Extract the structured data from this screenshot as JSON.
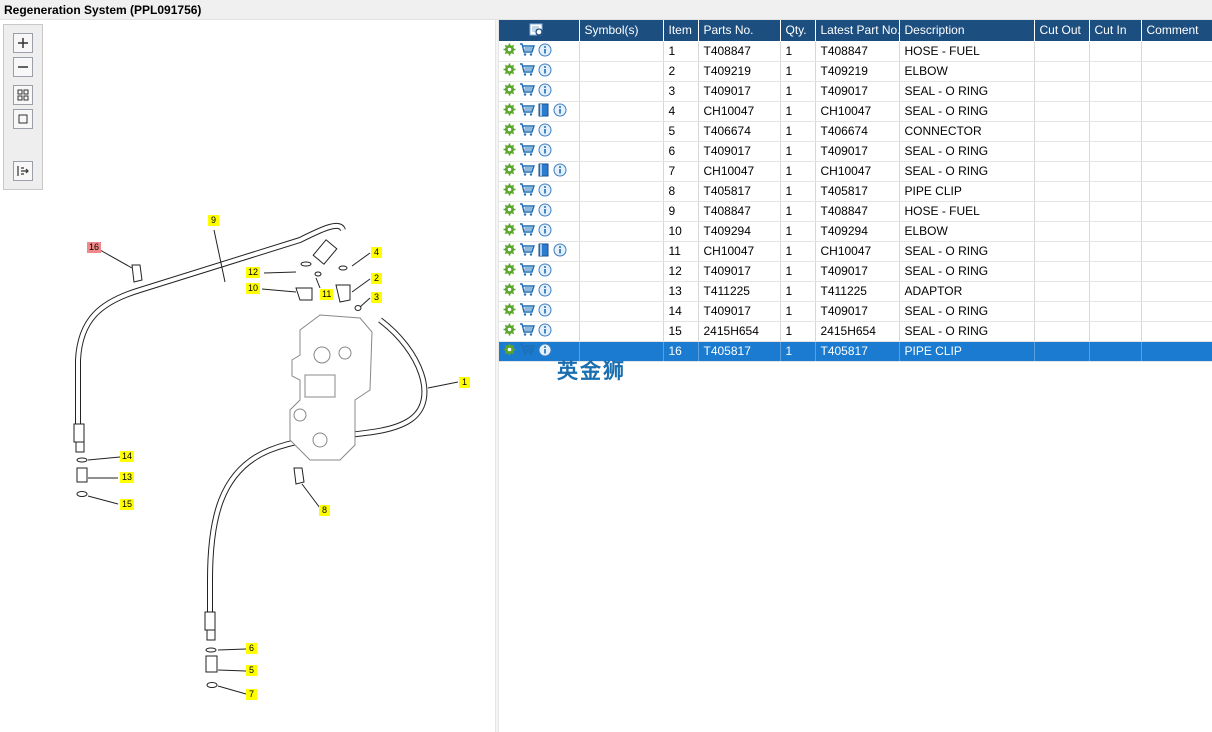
{
  "window": {
    "title": "Regeneration System (PPL091756)"
  },
  "toolbar": {
    "buttons": [
      "zoom-in-icon",
      "zoom-out-icon",
      "fit-all-icon",
      "fit-window-icon",
      "panel-toggle-icon"
    ]
  },
  "drawing": {
    "callouts": [
      "9",
      "16",
      "12",
      "4",
      "2",
      "10",
      "11",
      "3",
      "1",
      "14",
      "13",
      "15",
      "8",
      "6",
      "5",
      "7"
    ],
    "highlighted_callout": "16"
  },
  "table": {
    "columns": [
      "",
      "Symbol(s)",
      "Item",
      "Parts No.",
      "Qty.",
      "Latest Part No.",
      "Description",
      "Cut Out",
      "Cut In",
      "Comment"
    ],
    "rows": [
      {
        "item": "1",
        "parts_no": "T408847",
        "qty": "1",
        "latest": "T408847",
        "desc": "HOSE - FUEL",
        "doc": false
      },
      {
        "item": "2",
        "parts_no": "T409219",
        "qty": "1",
        "latest": "T409219",
        "desc": "ELBOW",
        "doc": false
      },
      {
        "item": "3",
        "parts_no": "T409017",
        "qty": "1",
        "latest": "T409017",
        "desc": "SEAL - O RING",
        "doc": false
      },
      {
        "item": "4",
        "parts_no": "CH10047",
        "qty": "1",
        "latest": "CH10047",
        "desc": "SEAL - O RING",
        "doc": true
      },
      {
        "item": "5",
        "parts_no": "T406674",
        "qty": "1",
        "latest": "T406674",
        "desc": "CONNECTOR",
        "doc": false
      },
      {
        "item": "6",
        "parts_no": "T409017",
        "qty": "1",
        "latest": "T409017",
        "desc": "SEAL - O RING",
        "doc": false
      },
      {
        "item": "7",
        "parts_no": "CH10047",
        "qty": "1",
        "latest": "CH10047",
        "desc": "SEAL - O RING",
        "doc": true
      },
      {
        "item": "8",
        "parts_no": "T405817",
        "qty": "1",
        "latest": "T405817",
        "desc": "PIPE CLIP",
        "doc": false
      },
      {
        "item": "9",
        "parts_no": "T408847",
        "qty": "1",
        "latest": "T408847",
        "desc": "HOSE - FUEL",
        "doc": false
      },
      {
        "item": "10",
        "parts_no": "T409294",
        "qty": "1",
        "latest": "T409294",
        "desc": "ELBOW",
        "doc": false
      },
      {
        "item": "11",
        "parts_no": "CH10047",
        "qty": "1",
        "latest": "CH10047",
        "desc": "SEAL - O RING",
        "doc": true
      },
      {
        "item": "12",
        "parts_no": "T409017",
        "qty": "1",
        "latest": "T409017",
        "desc": "SEAL - O RING",
        "doc": false
      },
      {
        "item": "13",
        "parts_no": "T411225",
        "qty": "1",
        "latest": "T411225",
        "desc": "ADAPTOR",
        "doc": false
      },
      {
        "item": "14",
        "parts_no": "T409017",
        "qty": "1",
        "latest": "T409017",
        "desc": "SEAL - O RING",
        "doc": false
      },
      {
        "item": "15",
        "parts_no": "2415H654",
        "qty": "1",
        "latest": "2415H654",
        "desc": "SEAL - O RING",
        "doc": false
      },
      {
        "item": "16",
        "parts_no": "T405817",
        "qty": "1",
        "latest": "T405817",
        "desc": "PIPE CLIP",
        "doc": false,
        "selected": true
      }
    ]
  },
  "watermark": {
    "text": "英金狮"
  },
  "colors": {
    "header_bg": "#1c4e80",
    "selected_bg": "#1a7bd0",
    "callout_bg": "#ffff00",
    "callout_highlight": "#f08a8a",
    "gear": "#5aa62a",
    "cart": "#1f6fb5"
  }
}
